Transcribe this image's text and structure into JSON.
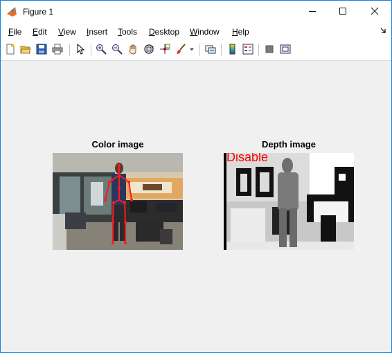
{
  "window": {
    "title": "Figure 1",
    "minimize_icon": "minimize-icon",
    "maximize_icon": "maximize-icon",
    "close_icon": "close-icon"
  },
  "menubar": {
    "items": [
      {
        "label": "File",
        "mnemonic": "F",
        "rest": "ile"
      },
      {
        "label": "Edit",
        "mnemonic": "E",
        "rest": "dit"
      },
      {
        "label": "View",
        "mnemonic": "V",
        "rest": "iew"
      },
      {
        "label": "Insert",
        "mnemonic": "I",
        "rest": "nsert"
      },
      {
        "label": "Tools",
        "mnemonic": "T",
        "rest": "ools"
      },
      {
        "label": "Desktop",
        "mnemonic": "D",
        "rest": "esktop"
      },
      {
        "label": "Window",
        "mnemonic": "W",
        "rest": "indow"
      },
      {
        "label": "Help",
        "mnemonic": "H",
        "rest": "elp"
      }
    ]
  },
  "toolbar": {
    "icons": [
      "new-figure-icon",
      "open-file-icon",
      "save-icon",
      "print-icon",
      "select-arrow-icon",
      "zoom-in-icon",
      "zoom-out-icon",
      "pan-icon",
      "rotate-3d-icon",
      "data-cursor-icon",
      "brush-icon",
      "link-plot-icon",
      "colorbar-icon",
      "legend-icon",
      "hide-plot-tools-icon",
      "show-plot-tools-icon"
    ]
  },
  "figure": {
    "color_axes": {
      "title": "Color image"
    },
    "depth_axes": {
      "title": "Depth image",
      "overlay_text": "Disable"
    }
  }
}
